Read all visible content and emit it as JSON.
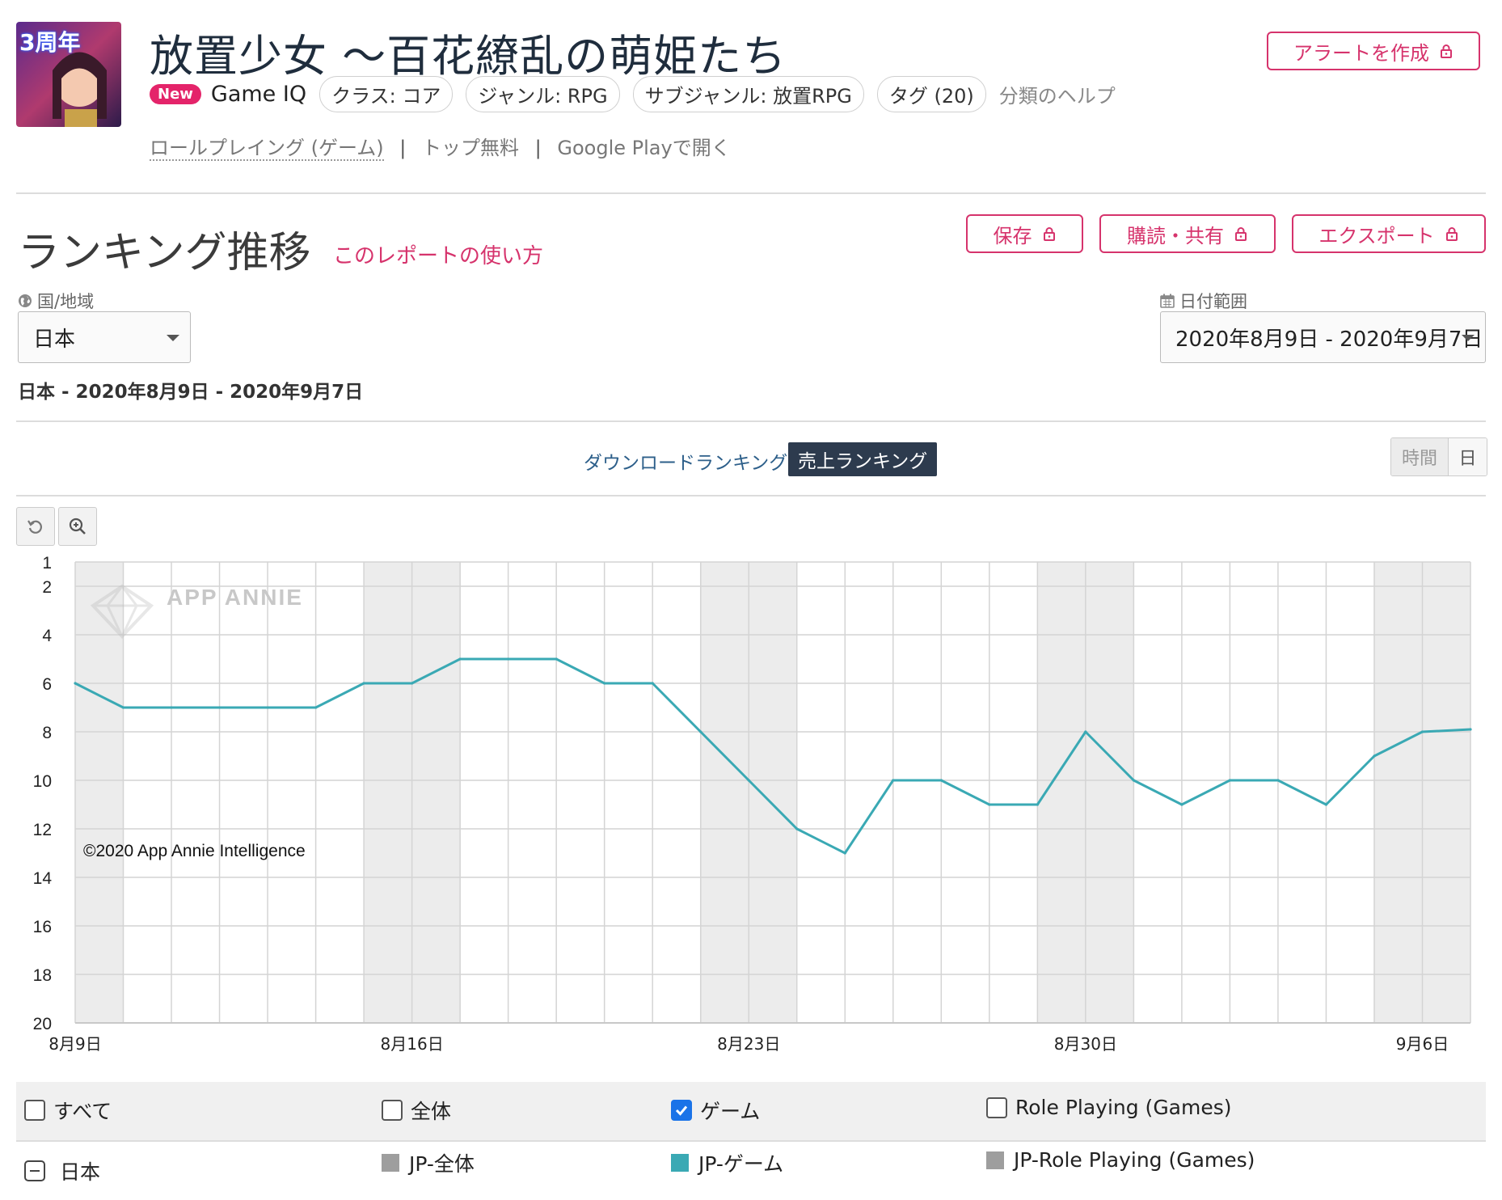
{
  "app": {
    "icon_badge": "3周年",
    "title": "放置少女 〜百花繚乱の萌姫たち",
    "new_badge": "New",
    "game_iq": "Game IQ",
    "tags": [
      "クラス: コア",
      "ジャンル: RPG",
      "サブジャンル: 放置RPG",
      "タグ (20)"
    ],
    "classify_help": "分類のヘルプ",
    "category_link": "ロールプレイング (ゲーム)",
    "top_free": "トップ無料",
    "google_play": "Google Playで開く",
    "alert_button": "アラートを作成"
  },
  "section": {
    "title": "ランキング推移",
    "howto": "このレポートの使い方",
    "save": "保存",
    "subscribe": "購読・共有",
    "export": "エクスポート"
  },
  "filters": {
    "country_label": "国/地域",
    "country_value": "日本",
    "date_label": "日付範囲",
    "date_value": "2020年8月9日 - 2020年9月7日",
    "summary": "日本 - 2020年8月9日 - 2020年9月7日"
  },
  "tabs": {
    "downloads": "ダウンロードランキング",
    "revenue": "売上ランキング",
    "hourly": "時間",
    "daily": "日"
  },
  "watermark": "APP ANNIE",
  "copyright": "©2020 App Annie Intelligence",
  "legend": {
    "all": "すべて",
    "overall": "全体",
    "game": "ゲーム",
    "role_playing": "Role Playing (Games)",
    "country": "日本",
    "series_overall": "JP-全体",
    "series_game": "JP-ゲーム",
    "series_rpg": "JP-Role Playing (Games)"
  },
  "colors": {
    "accent": "#d6336c",
    "line": "#3aa9b4",
    "weekend_band": "#ececec",
    "swatch_gray": "#9e9e9e"
  },
  "chart_data": {
    "type": "line",
    "x": [
      "8月9日",
      "8月10日",
      "8月11日",
      "8月12日",
      "8月13日",
      "8月14日",
      "8月15日",
      "8月16日",
      "8月17日",
      "8月18日",
      "8月19日",
      "8月20日",
      "8月21日",
      "8月22日",
      "8月23日",
      "8月24日",
      "8月25日",
      "8月26日",
      "8月27日",
      "8月28日",
      "8月29日",
      "8月30日",
      "8月31日",
      "9月1日",
      "9月2日",
      "9月3日",
      "9月4日",
      "9月5日",
      "9月6日",
      "9月7日"
    ],
    "series": [
      {
        "name": "JP-ゲーム",
        "values": [
          6,
          7,
          7,
          7,
          7,
          7,
          6,
          6,
          5,
          5,
          5,
          6,
          6,
          8,
          10,
          12,
          13,
          10,
          10,
          11,
          11,
          8,
          10,
          11,
          10,
          10,
          11,
          9,
          8,
          7.9
        ]
      }
    ],
    "y_ticks": [
      1,
      2,
      4,
      6,
      8,
      10,
      12,
      14,
      16,
      18,
      20
    ],
    "x_tick_labels": [
      "8月9日",
      "8月16日",
      "8月23日",
      "8月30日",
      "9月6日"
    ],
    "ylim": [
      1,
      20
    ],
    "y_inverted": true,
    "weekend_shaded": [
      "8月9日",
      "8月15日",
      "8月16日",
      "8月22日",
      "8月23日",
      "8月29日",
      "8月30日",
      "9月5日",
      "9月6日"
    ],
    "grid": true
  }
}
